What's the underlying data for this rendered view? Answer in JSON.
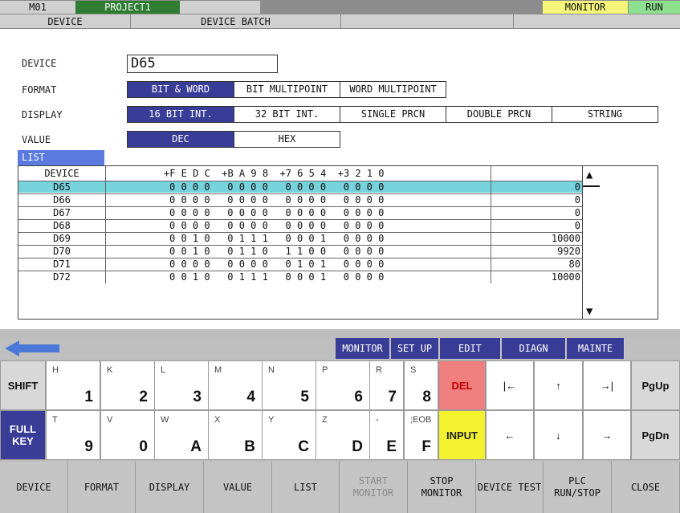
{
  "header": {
    "station": "M01",
    "project": "PROJECT1",
    "monitor": "MONITOR",
    "run": "RUN",
    "tab_device": "DEVICE",
    "tab_batch": "DEVICE BATCH"
  },
  "form": {
    "device_label": "DEVICE",
    "device_value": "D65",
    "format_label": "FORMAT",
    "format_opts": [
      "BIT & WORD",
      "BIT MULTIPOINT",
      "WORD MULTIPOINT"
    ],
    "display_label": "DISPLAY",
    "display_opts": [
      "16 BIT INT.",
      "32 BIT INT.",
      "SINGLE PRCN",
      "DOUBLE PRCN",
      "STRING"
    ],
    "value_label": "VALUE",
    "value_opts": [
      "DEC",
      "HEX"
    ],
    "list_label": "LIST"
  },
  "table": {
    "headers": {
      "device": "DEVICE",
      "bits": "+F E D C  +B A 9 8  +7 6 5 4  +3 2 1 0"
    },
    "rows": [
      {
        "device": "D65",
        "bits": "0 0 0 0   0 0 0 0   0 0 0 0   0 0 0 0",
        "value": "0"
      },
      {
        "device": "D66",
        "bits": "0 0 0 0   0 0 0 0   0 0 0 0   0 0 0 0",
        "value": "0"
      },
      {
        "device": "D67",
        "bits": "0 0 0 0   0 0 0 0   0 0 0 0   0 0 0 0",
        "value": "0"
      },
      {
        "device": "D68",
        "bits": "0 0 0 0   0 0 0 0   0 0 0 0   0 0 0 0",
        "value": "0"
      },
      {
        "device": "D69",
        "bits": "0 0 1 0   0 1 1 1   0 0 0 1   0 0 0 0",
        "value": "10000"
      },
      {
        "device": "D70",
        "bits": "0 0 1 0   0 1 1 0   1 1 0 0   0 0 0 0",
        "value": "9920"
      },
      {
        "device": "D71",
        "bits": "0 0 0 0   0 0 0 0   0 1 0 1   0 0 0 0",
        "value": "80"
      },
      {
        "device": "D72",
        "bits": "0 0 1 0   0 1 1 1   0 0 0 1   0 0 0 0",
        "value": "10000"
      }
    ]
  },
  "nav": {
    "monitor": "MONITOR",
    "setup": "SET UP",
    "edit": "EDIT",
    "diagn": "DIAGN",
    "mainte": "MAINTE"
  },
  "keys": {
    "shift": "SHIFT",
    "full1": "FULL",
    "full2": "KEY",
    "del": "DEL",
    "input": "INPUT",
    "home": "|←",
    "up": "↑",
    "end": "→|",
    "pgup": "PgUp",
    "left": "←",
    "down": "↓",
    "right": "→",
    "pgdn": "PgDn",
    "row1": [
      {
        "s": "H",
        "b": "1"
      },
      {
        "s": "K",
        "b": "2"
      },
      {
        "s": "L",
        "b": "3"
      },
      {
        "s": "M",
        "b": "4"
      },
      {
        "s": "N",
        "b": "5"
      },
      {
        "s": "P",
        "b": "6"
      },
      {
        "s": "R",
        "b": "7"
      },
      {
        "s": "S",
        "b": "8"
      }
    ],
    "row2": [
      {
        "s": "T",
        "b": "9"
      },
      {
        "s": "V",
        "b": "0"
      },
      {
        "s": "W",
        "b": "A"
      },
      {
        "s": "X",
        "b": "B"
      },
      {
        "s": "Y",
        "b": "C"
      },
      {
        "s": "Z",
        "b": "D"
      },
      {
        "s": "-",
        "b": "E"
      },
      {
        "s": ";EOB",
        "b": "F"
      }
    ]
  },
  "fkeys": [
    "DEVICE",
    "FORMAT",
    "DISPLAY",
    "VALUE",
    "LIST",
    "START MONITOR",
    "STOP MONITOR",
    "DEVICE TEST",
    "PLC RUN/STOP",
    "CLOSE"
  ]
}
